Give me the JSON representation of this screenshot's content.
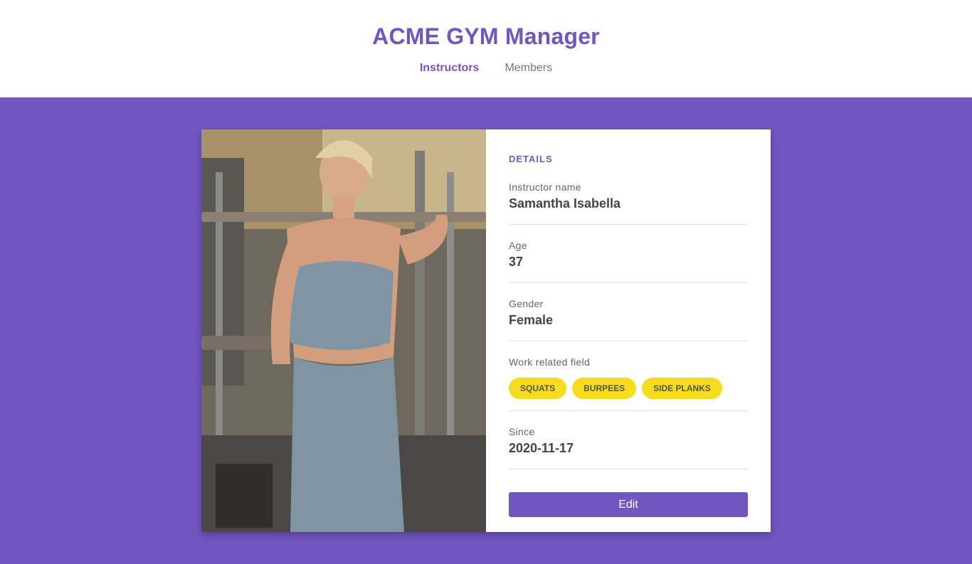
{
  "app": {
    "title": "ACME GYM Manager"
  },
  "nav": [
    {
      "label": "Instructors",
      "active": true
    },
    {
      "label": "Members",
      "active": false
    }
  ],
  "colors": {
    "brand": "#7156c0",
    "tag": "#f7dc1e"
  },
  "instructor": {
    "photo_icon": "instructor-photo",
    "section_title": "DETAILS",
    "name_label": "Instructor name",
    "name": "Samantha Isabella",
    "age_label": "Age",
    "age": "37",
    "gender_label": "Gender",
    "gender": "Female",
    "work_label": "Work related field",
    "services": [
      "SQUATS",
      "BURPEES",
      "SIDE PLANKS"
    ],
    "since_label": "Since",
    "since": "2020-11-17"
  },
  "actions": {
    "edit_label": "Edit"
  }
}
